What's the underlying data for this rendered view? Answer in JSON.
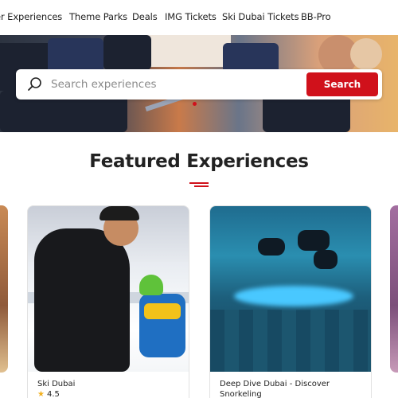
{
  "nav": {
    "items": [
      "er Experiences",
      "Theme Parks",
      "Deals",
      "IMG Tickets",
      "Ski Dubai Tickets",
      "BB-Pro"
    ]
  },
  "search": {
    "placeholder": "Search experiences",
    "button_label": "Search"
  },
  "section": {
    "title": "Featured Experiences"
  },
  "cards": [
    {
      "name": "Ski Dubai",
      "rating": "4.5"
    },
    {
      "name": "Deep Dive Dubai - Discover Snorkeling",
      "rating": ""
    }
  ],
  "colors": {
    "accent": "#d0111b",
    "star": "#f2b01e"
  }
}
